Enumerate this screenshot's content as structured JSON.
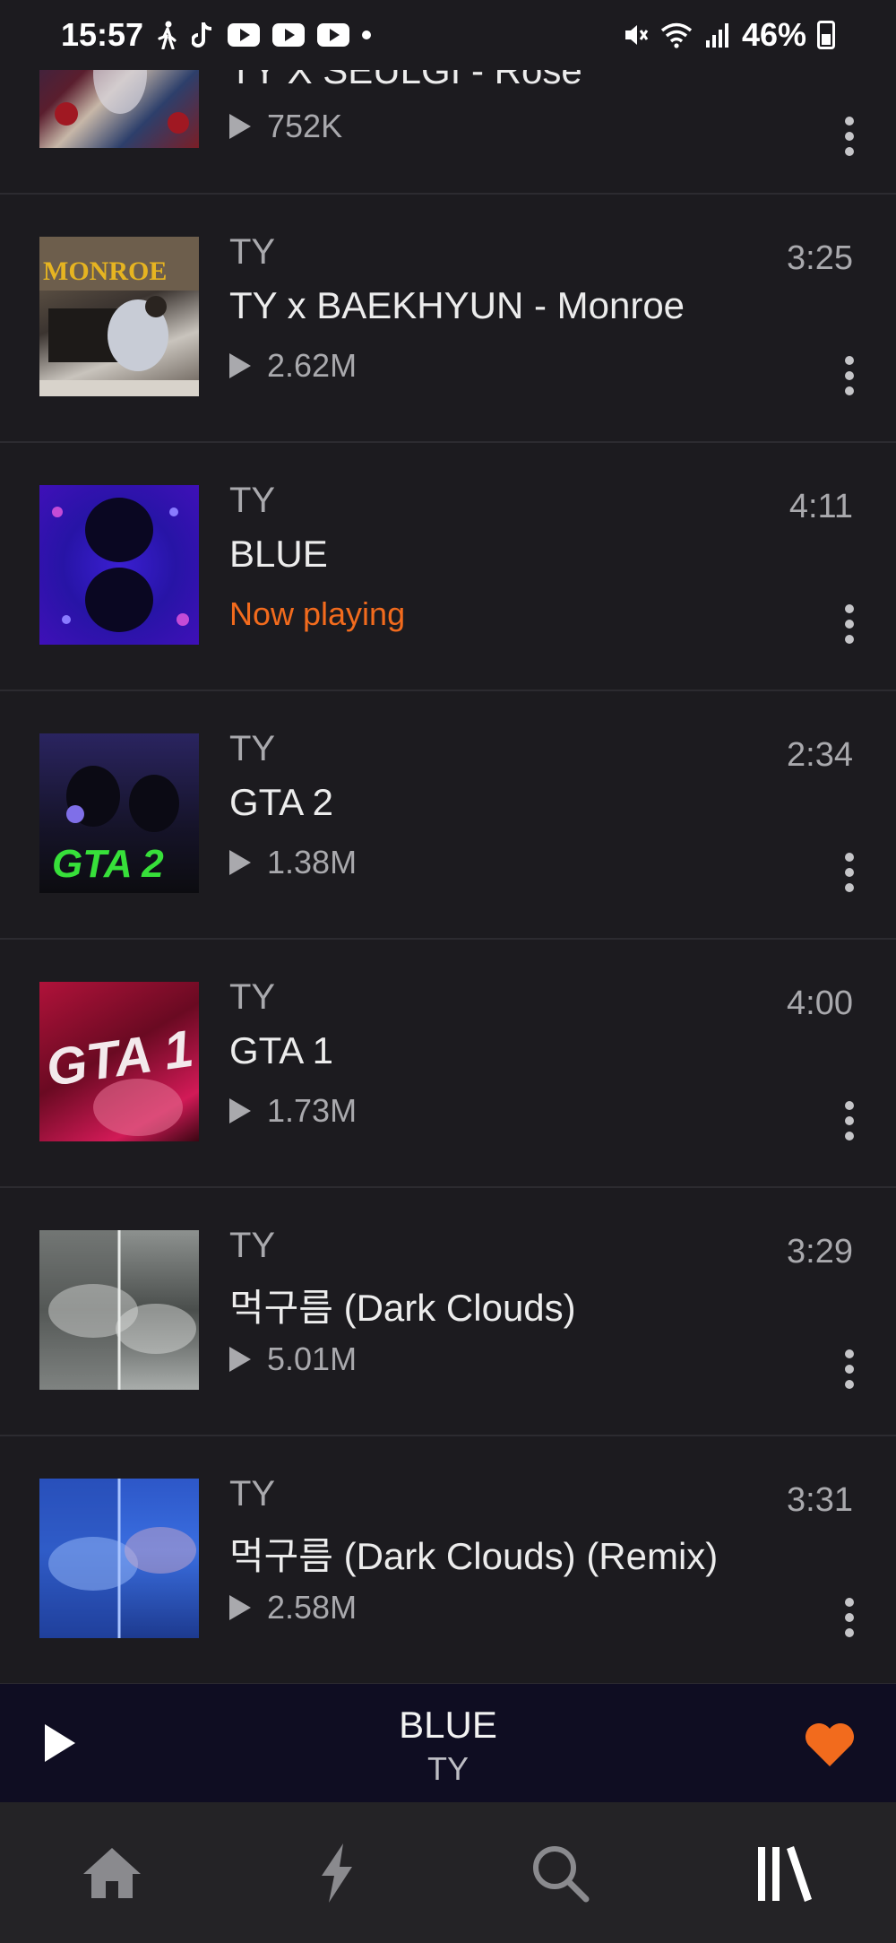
{
  "status_bar": {
    "time": "15:57",
    "battery": "46%",
    "icons": [
      "walking-icon",
      "tiktok-icon",
      "youtube-icon",
      "youtube-icon",
      "youtube-icon",
      "notification-dot-icon",
      "mute-icon",
      "wifi-icon",
      "signal-icon",
      "battery-icon"
    ]
  },
  "tracks": [
    {
      "artist": "",
      "title": "TY X SEULGI - Rose",
      "plays": "752K",
      "duration": ""
    },
    {
      "artist": "TY",
      "title": "TY x BAEKHYUN - Monroe",
      "plays": "2.62M",
      "duration": "3:25"
    },
    {
      "artist": "TY",
      "title": "BLUE",
      "status": "Now playing",
      "duration": "4:11"
    },
    {
      "artist": "TY",
      "title": "GTA 2",
      "plays": "1.38M",
      "duration": "2:34"
    },
    {
      "artist": "TY",
      "title": "GTA 1",
      "plays": "1.73M",
      "duration": "4:00"
    },
    {
      "artist": "TY",
      "title": "먹구름 (Dark Clouds)",
      "plays": "5.01M",
      "duration": "3:29"
    },
    {
      "artist": "TY",
      "title": "먹구름 (Dark Clouds) (Remix)",
      "plays": "2.58M",
      "duration": "3:31"
    }
  ],
  "mini_player": {
    "title": "BLUE",
    "artist": "TY",
    "liked": true,
    "accent": "#f26b1d"
  },
  "bottom_nav": [
    "home-icon",
    "stream-icon",
    "search-icon",
    "library-icon"
  ]
}
